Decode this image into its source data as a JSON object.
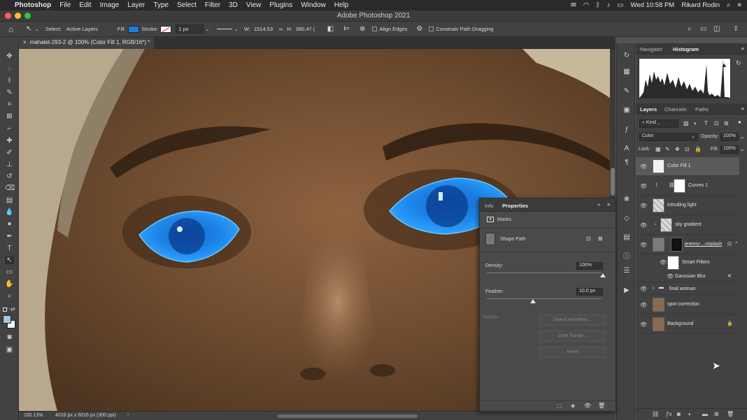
{
  "menubar": {
    "app": "Photoshop",
    "items": [
      "File",
      "Edit",
      "Image",
      "Layer",
      "Type",
      "Select",
      "Filter",
      "3D",
      "View",
      "Plugins",
      "Window",
      "Help"
    ],
    "datetime": "Wed 10:58 PM",
    "user": "Rikard Rodin"
  },
  "window": {
    "title": "Adobe Photoshop 2021"
  },
  "options": {
    "select_label": "Select:",
    "select_value": "Active Layers",
    "fill_label": "Fill:",
    "stroke_label": "Stroke:",
    "stroke_width": "1 px",
    "w_label": "W:",
    "w_value": "1514.53",
    "h_label": "H:",
    "h_value": "360.47 (",
    "align_edges": "Align Edges",
    "constrain": "Constrain Path Dragging",
    "fill_color": "#1e7de0"
  },
  "document": {
    "tab": "mahalet-293-2 @ 100% (Color Fill 1, RGB/16*) *"
  },
  "status": {
    "zoom": "100.13%",
    "size": "4016 px x 6016 px (300 ppi)"
  },
  "navigator": {
    "tabs": [
      "Navigator",
      "Histogram"
    ],
    "active": "Histogram"
  },
  "layers_panel": {
    "tabs": [
      "Layers",
      "Channels",
      "Paths"
    ],
    "filter": "Kind",
    "blend_mode": "Color",
    "opacity_label": "Opacity:",
    "opacity": "100%",
    "lock_label": "Lock:",
    "fill_label": "Fill:",
    "fill": "100%",
    "layers": [
      {
        "name": "Color Fill 1"
      },
      {
        "name": "Curves 1"
      },
      {
        "name": "intruding light"
      },
      {
        "name": "sky gradient"
      },
      {
        "name": "jeremy-...nsplash"
      },
      {
        "name": "Smart Filters"
      },
      {
        "name": "Gaussian Blur"
      },
      {
        "name": "final woman"
      },
      {
        "name": "spot correction"
      },
      {
        "name": "Background"
      }
    ]
  },
  "properties": {
    "tabs": [
      "Info",
      "Properties"
    ],
    "active": "Properties",
    "section": "Masks",
    "shape": "Shape Path",
    "density_label": "Density:",
    "density": "100%",
    "feather_label": "Feather:",
    "feather": "10.0 px",
    "refine_label": "Refine:",
    "buttons": [
      "Select and Mask...",
      "Color Range...",
      "Invert"
    ]
  }
}
